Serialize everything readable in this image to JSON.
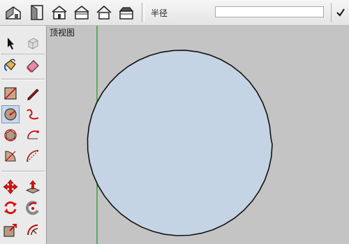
{
  "toolbar": {
    "buttons": [
      {
        "icon": "iso-view-icon"
      },
      {
        "icon": "top-view-icon"
      },
      {
        "icon": "front-view-icon"
      },
      {
        "icon": "right-view-icon"
      },
      {
        "icon": "back-view-icon"
      },
      {
        "icon": "left-view-icon"
      }
    ],
    "vcb_label": "半径",
    "vcb_value": "",
    "confirm_icon": "checkmark-icon"
  },
  "tools": [
    {
      "name": "select-tool",
      "icon": "arrow-cursor-icon"
    },
    {
      "name": "make-component-tool",
      "icon": "component-box-icon"
    },
    {
      "name": "paint-bucket-tool",
      "icon": "paint-bucket-icon"
    },
    {
      "name": "eraser-tool",
      "icon": "eraser-icon"
    },
    {
      "name": "rectangle-tool",
      "icon": "rectangle-icon"
    },
    {
      "name": "line-tool",
      "icon": "pencil-icon"
    },
    {
      "name": "circle-tool",
      "icon": "circle-icon",
      "active": true
    },
    {
      "name": "freehand-tool",
      "icon": "freehand-icon"
    },
    {
      "name": "polygon-tool",
      "icon": "polygon-icon"
    },
    {
      "name": "arc-tool",
      "icon": "arc-icon"
    },
    {
      "name": "pie-tool",
      "icon": "pie-icon"
    },
    {
      "name": "two-point-arc-tool",
      "icon": "two-point-arc-icon"
    },
    {
      "name": "move-tool",
      "icon": "move-arrows-icon"
    },
    {
      "name": "push-pull-tool",
      "icon": "push-pull-icon"
    },
    {
      "name": "rotate-tool",
      "icon": "rotate-icon"
    },
    {
      "name": "follow-me-tool",
      "icon": "follow-me-icon"
    },
    {
      "name": "scale-tool",
      "icon": "scale-icon"
    },
    {
      "name": "offset-tool",
      "icon": "offset-icon"
    }
  ],
  "viewport": {
    "view_name": "顶视图",
    "background_color": "#c4c4c4",
    "circle_fill": "#c5d4e4",
    "circle_stroke": "#111111",
    "axis_color": "#1a9a1a"
  }
}
